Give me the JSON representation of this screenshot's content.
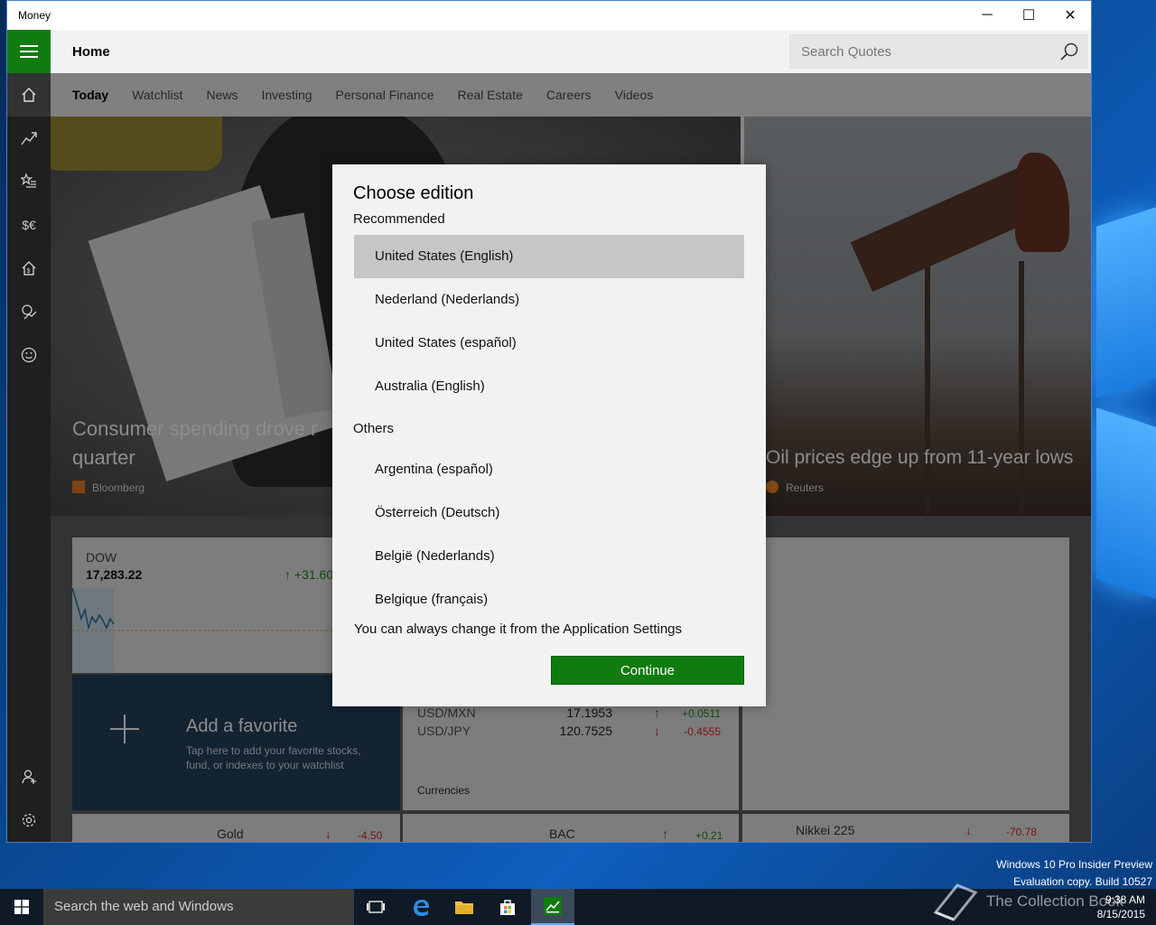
{
  "window": {
    "title": "Money",
    "min": "─",
    "max": "☐",
    "close": "✕"
  },
  "header": {
    "title": "Home",
    "search_placeholder": "Search Quotes"
  },
  "tabs": [
    "Today",
    "Watchlist",
    "News",
    "Investing",
    "Personal Finance",
    "Real Estate",
    "Careers",
    "Videos"
  ],
  "rail_icons": [
    "home-icon",
    "chart-icon",
    "watchlist-icon",
    "currency-icon",
    "real-estate-icon",
    "world-markets-icon",
    "smiley-icon",
    "user-icon",
    "gear-icon"
  ],
  "hero": {
    "left_headline_line1": "Consumer spending drove r",
    "left_headline_line2": "quarter",
    "left_source": "Bloomberg",
    "right_headline": "Oil prices edge up from 11-year lows",
    "right_source": "Reuters"
  },
  "dow": {
    "label": "DOW",
    "value": "17,283.22",
    "change": "↑ +31.60"
  },
  "favorite": {
    "title": "Add a favorite",
    "subtitle": "Tap here to add your favorite stocks, fund, or indexes to your watchlist"
  },
  "currencies": {
    "rows": [
      {
        "pair": "USD/MXN",
        "rate": "17.1953",
        "arrow": "↑",
        "change": "+0.0511",
        "dir": "up"
      },
      {
        "pair": "USD/JPY",
        "rate": "120.7525",
        "arrow": "↓",
        "change": "-0.4555",
        "dir": "down"
      }
    ],
    "caption": "Currencies"
  },
  "bottom_row": [
    {
      "name": "Gold",
      "arrow": "↓",
      "change": "-4.50"
    },
    {
      "name": "BAC",
      "arrow": "↑",
      "change": "+0.21"
    },
    {
      "name": "Nikkei 225",
      "arrow": "↓",
      "change": "-70.78"
    }
  ],
  "dialog": {
    "title": "Choose edition",
    "recommended_label": "Recommended",
    "recommended": [
      "United States (English)",
      "Nederland (Nederlands)",
      "United States (español)",
      "Australia (English)"
    ],
    "others_label": "Others",
    "others": [
      "Argentina (español)",
      "Österreich (Deutsch)",
      "België (Nederlands)",
      "Belgique (français)"
    ],
    "selected": "United States (English)",
    "hint": "You can always change it from the Application Settings",
    "continue_label": "Continue"
  },
  "taskbar": {
    "search_placeholder": "Search the web and Windows",
    "time": "9:38 AM",
    "date": "8/15/2015",
    "overlay_text": "The Collection Book"
  },
  "desktop_watermark": {
    "line1": "Windows 10 Pro Insider Preview",
    "line2": "Evaluation copy. Build 10527"
  },
  "colors": {
    "accent": "#107c10",
    "favorite_tile": "#24405c",
    "up": "#1f8a1f",
    "down": "#d02a2a"
  }
}
